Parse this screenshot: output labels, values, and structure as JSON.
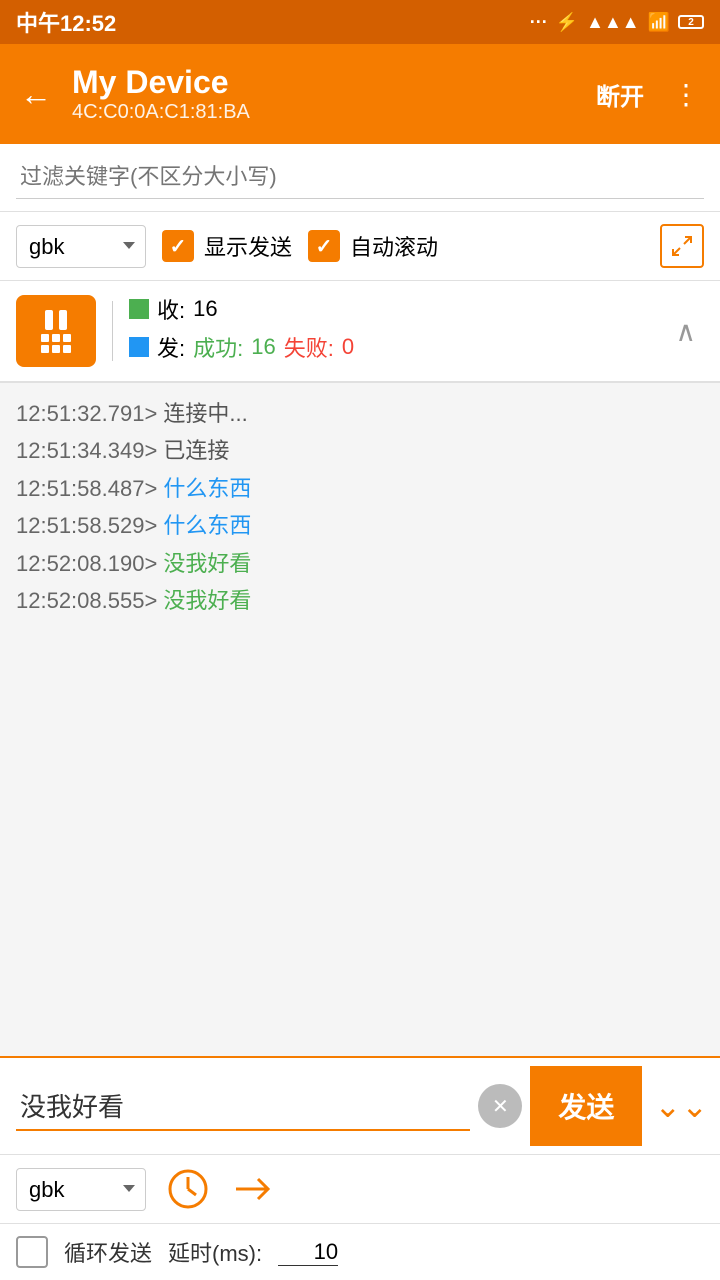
{
  "statusBar": {
    "time": "中午12:52",
    "batteryLevel": "2"
  },
  "appBar": {
    "deviceName": "My Device",
    "deviceMac": "4C:C0:0A:C1:81:BA",
    "disconnectLabel": "断开",
    "backIcon": "←"
  },
  "filter": {
    "placeholder": "过滤关键字(不区分大小写)"
  },
  "controls": {
    "encoding": "gbk",
    "showSendLabel": "显示发送",
    "autoScrollLabel": "自动滚动"
  },
  "stats": {
    "receivedLabel": "收:",
    "receivedCount": "16",
    "sentLabel": "发:",
    "successLabel": "成功:",
    "successCount": "16",
    "failLabel": "失败:",
    "failCount": "0"
  },
  "logs": [
    {
      "time": "12:51:32.791>",
      "text": " 连接中...",
      "color": "gray"
    },
    {
      "time": "12:51:34.349>",
      "text": " 已连接",
      "color": "gray"
    },
    {
      "time": "12:51:58.487>",
      "text": " 什么东西",
      "color": "blue"
    },
    {
      "time": "12:51:58.529>",
      "text": " 什么东西",
      "color": "blue"
    },
    {
      "time": "12:52:08.190>",
      "text": " 没我好看",
      "color": "green"
    },
    {
      "time": "12:52:08.555>",
      "text": " 没我好看",
      "color": "green"
    }
  ],
  "bottomInput": {
    "value": "没我好看",
    "sendLabel": "发送",
    "encoding": "gbk",
    "loopLabel": "循环发送",
    "delayLabel": "延时(ms):",
    "delayValue": "10"
  }
}
